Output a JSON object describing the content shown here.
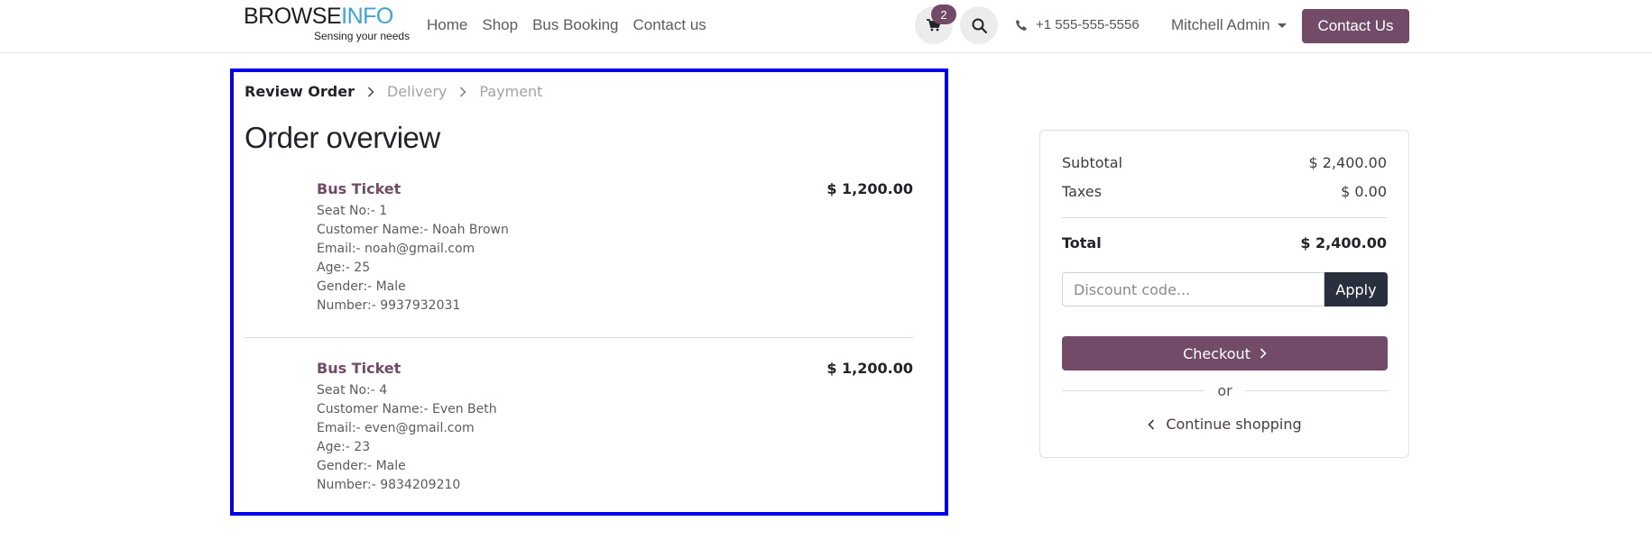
{
  "header": {
    "logo_main_dark": "BROWSE",
    "logo_main_accent": "INFO",
    "logo_tagline": "Sensing your needs",
    "nav": [
      "Home",
      "Shop",
      "Bus Booking",
      "Contact us"
    ],
    "cart_count": "2",
    "phone": "+1 555-555-5556",
    "user": "Mitchell Admin",
    "contact_button": "Contact Us"
  },
  "breadcrumb": {
    "active": "Review Order",
    "step2": "Delivery",
    "step3": "Payment"
  },
  "page_title": "Order overview",
  "items": [
    {
      "name": "Bus Ticket",
      "price": "$ 1,200.00",
      "details": [
        "Seat No:- 1",
        "Customer Name:- Noah Brown",
        "Email:- noah@gmail.com",
        "Age:- 25",
        "Gender:- Male",
        "Number:- 9937932031"
      ]
    },
    {
      "name": "Bus Ticket",
      "price": "$ 1,200.00",
      "details": [
        "Seat No:- 4",
        "Customer Name:- Even Beth",
        "Email:- even@gmail.com",
        "Age:- 23",
        "Gender:- Male",
        "Number:- 9834209210"
      ]
    }
  ],
  "summary": {
    "subtotal_label": "Subtotal",
    "subtotal_value": "$ 2,400.00",
    "taxes_label": "Taxes",
    "taxes_value": "$ 0.00",
    "total_label": "Total",
    "total_value": "$ 2,400.00",
    "discount_placeholder": "Discount code...",
    "apply_label": "Apply",
    "checkout_label": "Checkout",
    "or_label": "or",
    "continue_label": "Continue shopping"
  },
  "colors": {
    "brand": "#714b67",
    "accent_logo": "#3aa3d8",
    "highlight_border": "#0000ee",
    "apply_button": "#2a2f3d"
  }
}
